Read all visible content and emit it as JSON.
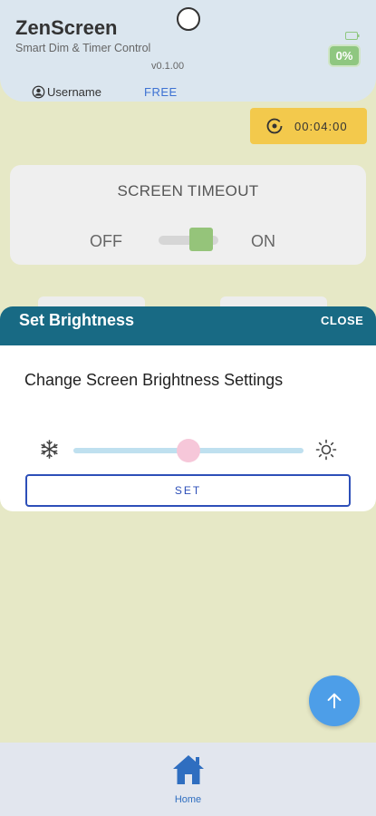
{
  "app": {
    "title": "ZenScreen",
    "subtitle": "Smart Dim & Timer Control",
    "version": "v0.1.00"
  },
  "user": {
    "username": "Username",
    "plan": "FREE"
  },
  "battery": {
    "percent_label": "0%",
    "icon": "battery-icon"
  },
  "timer": {
    "icon": "timer-icon",
    "value": "00:04:00"
  },
  "screen_timeout": {
    "title": "SCREEN TIMEOUT",
    "off_label": "OFF",
    "on_label": "ON",
    "state": "on"
  },
  "brightness_modal": {
    "title": "Set Brightness",
    "close_label": "CLOSE",
    "subtitle": "Change Screen Brightness Settings",
    "slider_level": 0.5,
    "min_icon": "snowflake-icon",
    "max_icon": "sun-icon",
    "set_label": "SET"
  },
  "fab": {
    "icon": "arrow-up-icon"
  },
  "bottom_nav": {
    "items": [
      {
        "label": "Home",
        "icon": "home-icon",
        "active": true
      }
    ]
  },
  "colors": {
    "background": "#e6e8c6",
    "header": "#dbe6ef",
    "modal_header": "#186a84",
    "accent_blue": "#2d4fb8",
    "timer": "#f3c94c",
    "battery": "#8fc780",
    "fab": "#4d9ee8"
  }
}
